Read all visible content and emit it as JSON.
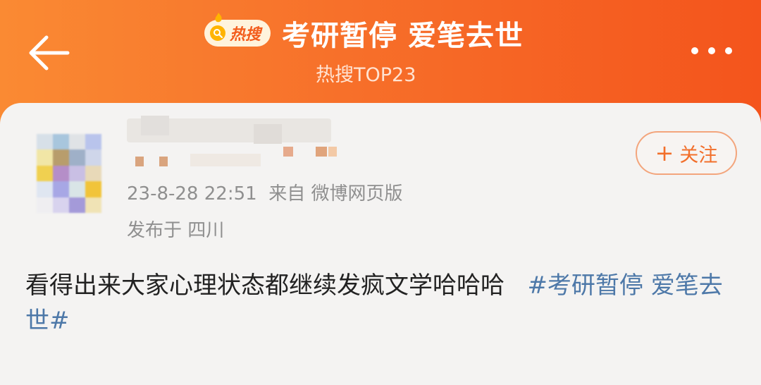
{
  "header": {
    "badge_label": "热搜",
    "title": "考研暂停 爱笔去世",
    "subtitle": "热搜TOP23"
  },
  "post": {
    "timestamp": "23-8-28 22:51",
    "source": "来自 微博网页版",
    "location": "发布于 四川",
    "follow_label": "关注",
    "text": "看得出来大家心理状态都继续发疯文学哈哈哈",
    "hashtag": "#考研暂停 爱笔去世#"
  },
  "colors": {
    "header_start": "#fa8a33",
    "header_end": "#f4541c",
    "follow": "#f26f2b",
    "hashtag": "#4d78a8"
  },
  "icons": [
    "back-arrow-icon",
    "hot-search-icon",
    "more-icon"
  ]
}
